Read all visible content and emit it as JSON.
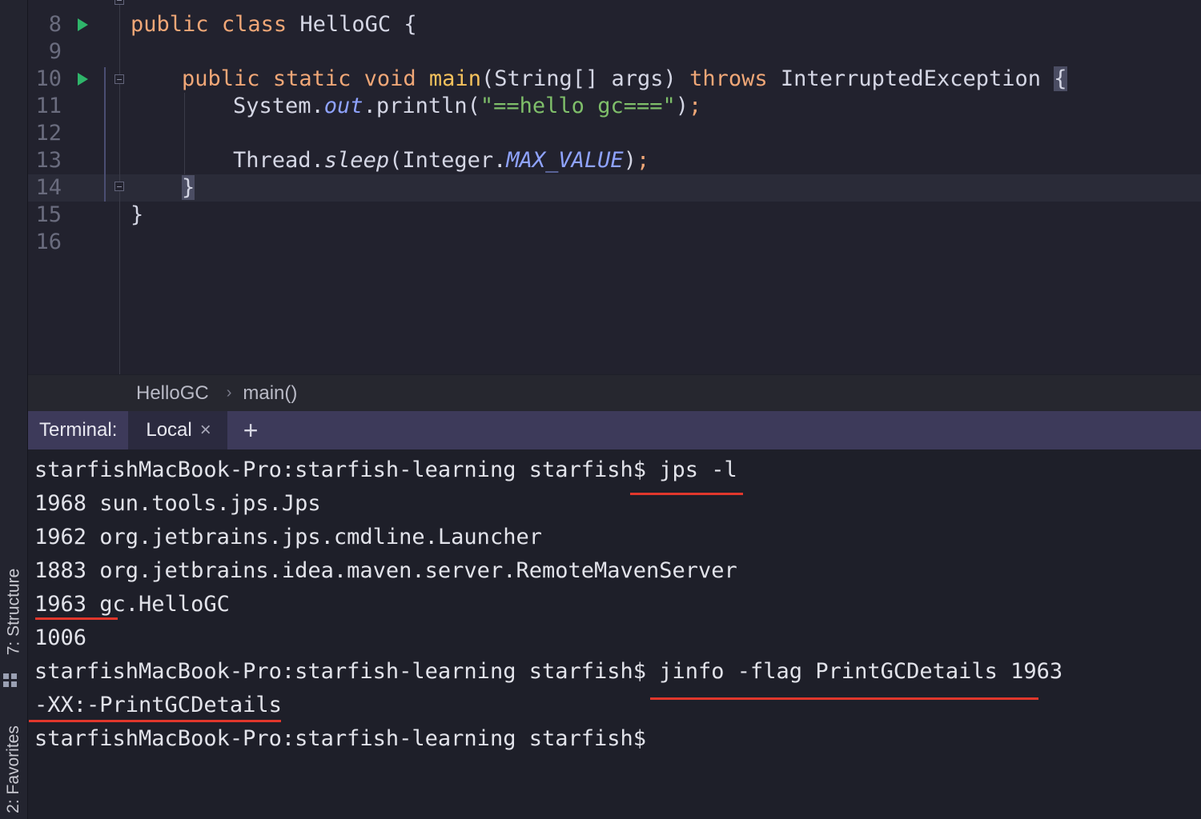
{
  "sidebar": {
    "structure_label": "7: Structure",
    "favorites_label": "2: Favorites"
  },
  "editor": {
    "lines": [
      {
        "n": "8",
        "text": "public class HelloGC {"
      },
      {
        "n": "9",
        "text": ""
      },
      {
        "n": "10",
        "text": "public static void main(String[] args) throws InterruptedException {"
      },
      {
        "n": "11",
        "text": "System.out.println(\"==hello gc===\");"
      },
      {
        "n": "12",
        "text": ""
      },
      {
        "n": "13",
        "text": "Thread.sleep(Integer.MAX_VALUE);"
      },
      {
        "n": "14",
        "text": "}"
      },
      {
        "n": "15",
        "text": "}"
      },
      {
        "n": "16",
        "text": ""
      }
    ],
    "tokens": {
      "public": "public",
      "class": "class",
      "class_name": "HelloGC",
      "open_brace": "{",
      "static": "static",
      "void": "void",
      "main": "main",
      "params": "(String[] args)",
      "throws": "throws",
      "exception": "InterruptedException",
      "system": "System.",
      "out": "out",
      "println": ".println(",
      "string": "\"==hello gc===\"",
      "close_call": ");",
      "thread": "Thread.",
      "sleep": "sleep",
      "integer": "(Integer.",
      "max_value": "MAX_VALUE",
      "close_paren": ")",
      "semicolon": ";",
      "close_brace": "}"
    }
  },
  "breadcrumb": {
    "items": [
      "HelloGC",
      "main()"
    ],
    "separator": "›"
  },
  "terminal": {
    "label": "Terminal:",
    "tab_label": "Local",
    "close_glyph": "×",
    "add_glyph": "+",
    "lines": [
      "starfishMacBook-Pro:starfish-learning starfish$ jps -l",
      "1968 sun.tools.jps.Jps",
      "1962 org.jetbrains.jps.cmdline.Launcher",
      "1883 org.jetbrains.idea.maven.server.RemoteMavenServer",
      "1963 gc.HelloGC",
      "1006",
      "starfishMacBook-Pro:starfish-learning starfish$ jinfo -flag PrintGCDetails 1963",
      "-XX:-PrintGCDetails",
      "starfishMacBook-Pro:starfish-learning starfish$"
    ]
  },
  "colors": {
    "annotation_underline": "#e1372c",
    "keyword": "#f0a777",
    "function": "#f5c25d",
    "string": "#7fbf6a",
    "field": "#8fa3ff",
    "run_icon": "#2fb56a"
  }
}
